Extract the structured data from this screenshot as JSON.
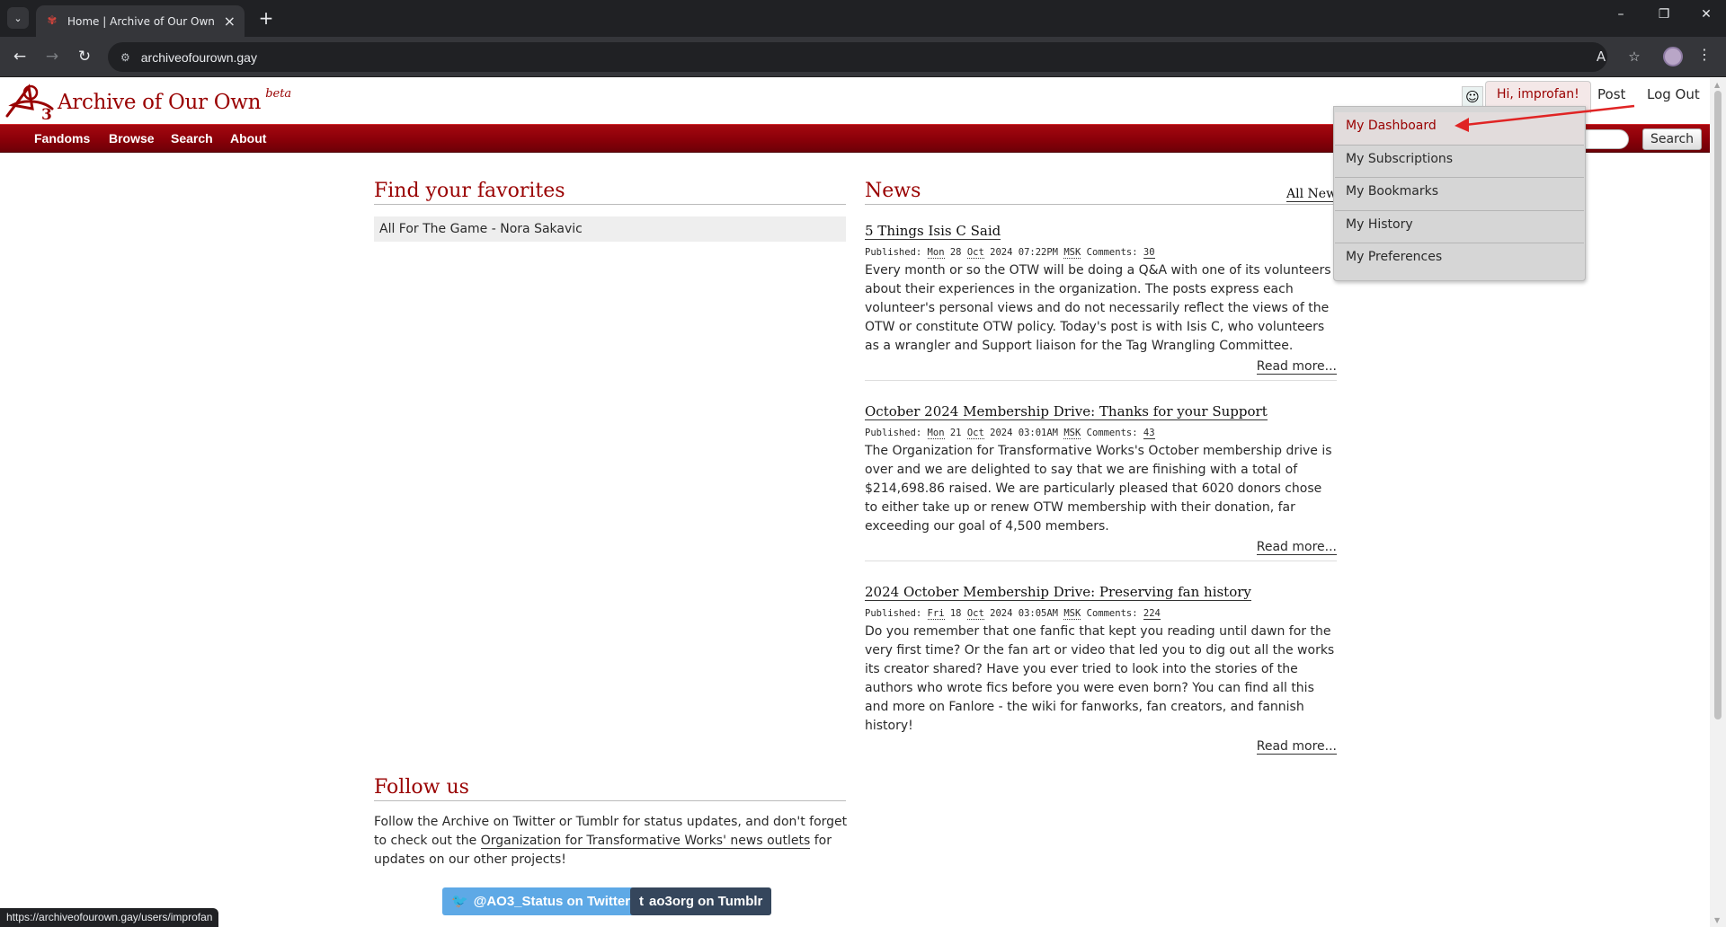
{
  "browser": {
    "tab_title": "Home | Archive of Our Own",
    "url": "archiveofourown.gay",
    "status_url": "https://archiveofourown.gay/users/improfan",
    "tab_search_glyph": "⌄",
    "new_tab_glyph": "+",
    "close_glyph": "×"
  },
  "site": {
    "name": "Archive of Our Own",
    "beta": "beta",
    "brand_color": "#990000"
  },
  "user_nav": {
    "greeting": "Hi, improfan!",
    "post": "Post",
    "logout": "Log Out",
    "menu": [
      "My Dashboard",
      "My Subscriptions",
      "My Bookmarks",
      "My History",
      "My Preferences"
    ]
  },
  "primary_nav": {
    "items": [
      "Fandoms",
      "Browse",
      "Search",
      "About"
    ],
    "search_button": "Search"
  },
  "favorites": {
    "heading": "Find your favorites",
    "items": [
      "All For The Game - Nora Sakavic"
    ]
  },
  "news": {
    "heading": "News",
    "all_news": "All News",
    "published_label": "Published:",
    "comments_label": "Comments:",
    "read_more": "Read more...",
    "posts": [
      {
        "title": "5 Things Isis C Said",
        "day": "Mon",
        "date": "28",
        "month": "Oct",
        "year": "2024",
        "time": "07:22PM",
        "tz": "MSK",
        "comments": "30",
        "body": "Every month or so the OTW will be doing a Q&A with one of its volunteers about their experiences in the organization. The posts express each volunteer's personal views and do not necessarily reflect the views of the OTW or constitute OTW policy. Today's post is with Isis C, who volunteers as a wrangler and Support liaison for the Tag Wrangling Committee."
      },
      {
        "title": "October 2024 Membership Drive: Thanks for your Support",
        "day": "Mon",
        "date": "21",
        "month": "Oct",
        "year": "2024",
        "time": "03:01AM",
        "tz": "MSK",
        "comments": "43",
        "body": "The Organization for Transformative Works's October membership drive is over and we are delighted to say that we are finishing with a total of $214,698.86 raised. We are particularly pleased that 6020 donors chose to either take up or renew OTW membership with their donation, far exceeding our goal of 4,500 members."
      },
      {
        "title": "2024 October Membership Drive: Preserving fan history",
        "day": "Fri",
        "date": "18",
        "month": "Oct",
        "year": "2024",
        "time": "03:05AM",
        "tz": "MSK",
        "comments": "224",
        "body": "Do you remember that one fanfic that kept you reading until dawn for the very first time? Or the fan art or video that led you to dig out all the works its creator shared? Have you ever tried to look into the stories of the authors who wrote fics before you were even born? You can find all this and more on Fanlore - the wiki for fanworks, fan creators, and fannish history!"
      }
    ]
  },
  "follow": {
    "heading": "Follow us",
    "text_before": "Follow the Archive on Twitter or Tumblr for status updates, and don't forget to check out the ",
    "link": "Organization for Transformative Works' news outlets",
    "text_after": " for updates on our other projects!",
    "twitter_label": "@AO3_Status on Twitter",
    "tumblr_label": "ao3org on Tumblr",
    "twitter_color": "#5ea9e6",
    "tumblr_color": "#35465c"
  }
}
